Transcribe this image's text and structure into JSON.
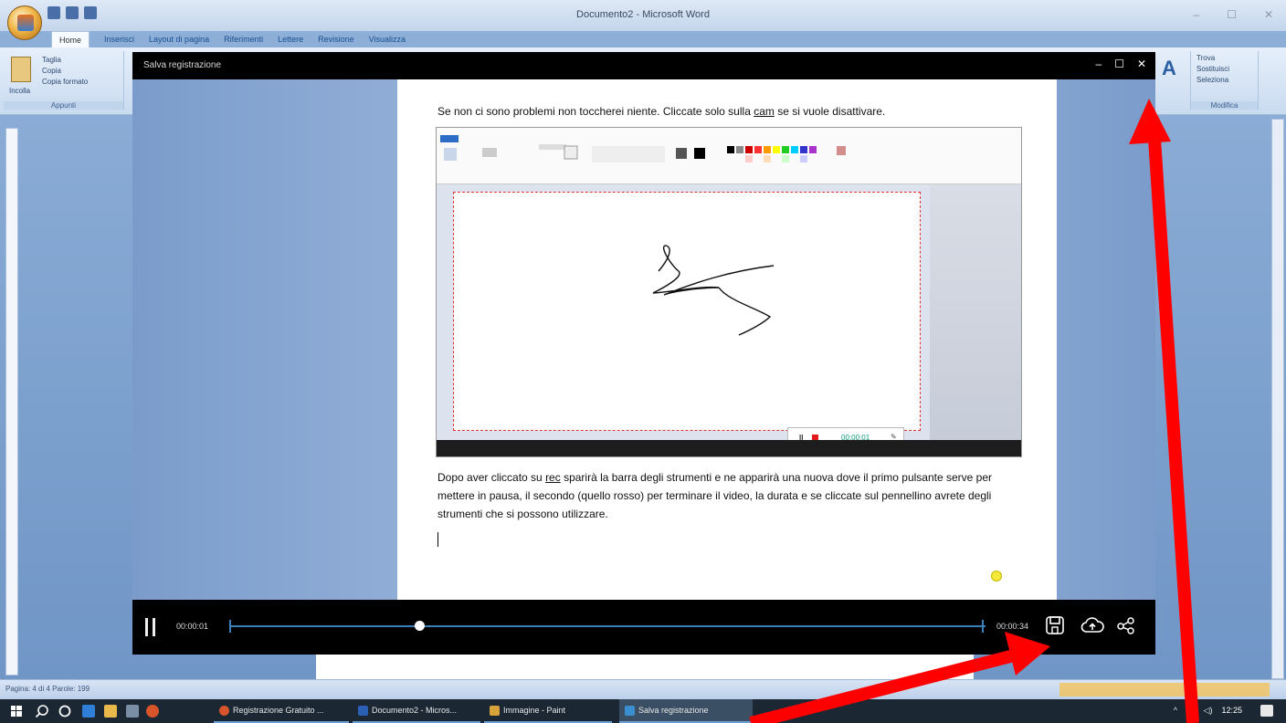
{
  "word": {
    "title": "Documento2 - Microsoft Word",
    "tabs": [
      "Home",
      "Inserisci",
      "Layout di pagina",
      "Riferimenti",
      "Lettere",
      "Revisione",
      "Visualizza"
    ],
    "clipboard": {
      "paste": "Incolla",
      "cut": "Taglia",
      "copy": "Copia",
      "format_painter": "Copia formato",
      "group": "Appunti"
    },
    "editing": {
      "find": "Trova",
      "replace": "Sostituisci",
      "select": "Seleziona",
      "group": "Modifica"
    },
    "statusbar": "Pagina: 4 di 4   Parole: 199"
  },
  "recorder": {
    "title": "Salva registrazione",
    "controls": {
      "minimize": "–",
      "maximize": "☐",
      "close": "✕"
    },
    "time_current": "00:00:01",
    "time_total": "00:00:34",
    "progress": 0.25,
    "buttons": {
      "save": "save-icon",
      "upload": "cloud-upload-icon",
      "share": "share-icon"
    }
  },
  "document": {
    "line1_pre": "Se non ci sono problemi non toccherei niente. Cliccate solo sulla ",
    "line1_link": "cam",
    "line1_post": " se si vuole disattivare.",
    "para_pre": "Dopo aver cliccato su ",
    "para_link": "rec",
    "para_post": " sparirà la barra degli strumenti e ne apparirà una nuova dove il primo pulsante serve per mettere in pausa, il secondo (quello rosso) per terminare il video, la durata e se cliccate sul pennellino avrete degli strumenti che si possono utilizzare.",
    "paint_rec_time": "00:00:01"
  },
  "taskbar": {
    "apps": [
      "Registrazione Gratuito ...",
      "Documento2 - Micros...",
      "Immagine - Paint",
      "Salva registrazione"
    ],
    "clock": "12:25"
  },
  "colors": {
    "accent": "#3b7fb8",
    "annotation": "#ff0000",
    "recorder_bg": "#000000"
  }
}
